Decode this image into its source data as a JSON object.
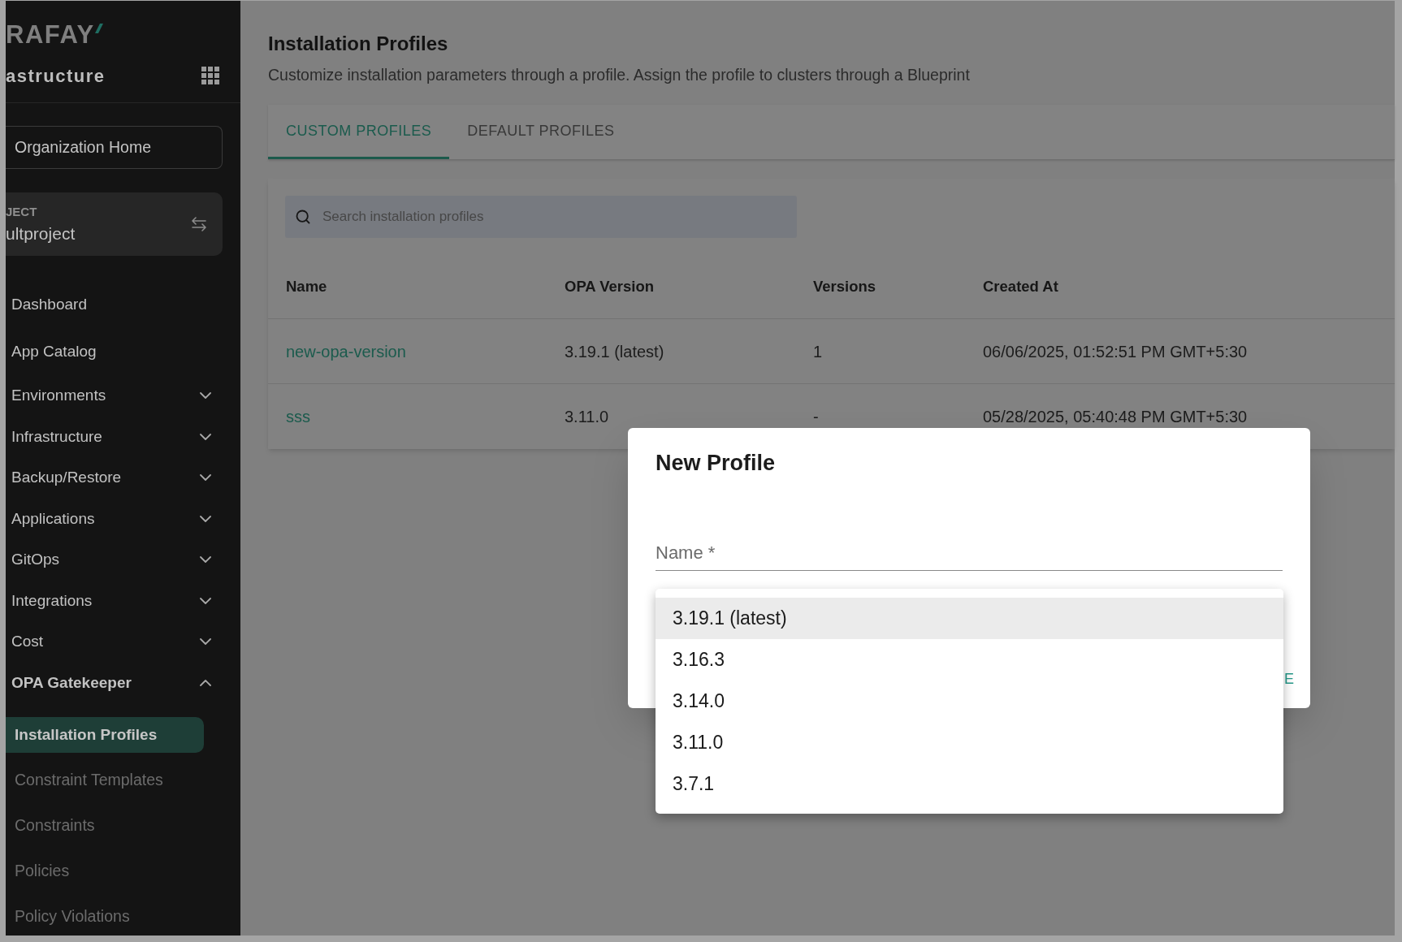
{
  "sidebar": {
    "logo": "RAFAY",
    "workspace": "astructure",
    "org_home": "Organization Home",
    "project": {
      "label": "JECT",
      "name": "ultproject"
    },
    "nav": [
      {
        "label": "Dashboard",
        "kind": "link"
      },
      {
        "label": "App Catalog",
        "kind": "link"
      },
      {
        "label": "Environments",
        "kind": "group",
        "expanded": false
      },
      {
        "label": "Infrastructure",
        "kind": "group",
        "expanded": false
      },
      {
        "label": "Backup/Restore",
        "kind": "group",
        "expanded": false
      },
      {
        "label": "Applications",
        "kind": "group",
        "expanded": false
      },
      {
        "label": "GitOps",
        "kind": "group",
        "expanded": false
      },
      {
        "label": "Integrations",
        "kind": "group",
        "expanded": false
      },
      {
        "label": "Cost",
        "kind": "group",
        "expanded": false
      },
      {
        "label": "OPA Gatekeeper",
        "kind": "group",
        "expanded": true,
        "children": [
          {
            "label": "Installation Profiles",
            "selected": true
          },
          {
            "label": "Constraint Templates",
            "selected": false
          },
          {
            "label": "Constraints",
            "selected": false
          },
          {
            "label": "Policies",
            "selected": false
          },
          {
            "label": "Policy Violations",
            "selected": false
          }
        ]
      }
    ]
  },
  "page": {
    "title": "Installation Profiles",
    "subtitle": "Customize installation parameters through a profile. Assign the profile to clusters through a Blueprint"
  },
  "tabs": [
    {
      "label": "CUSTOM PROFILES",
      "selected": true
    },
    {
      "label": "DEFAULT PROFILES",
      "selected": false
    }
  ],
  "search": {
    "placeholder": "Search installation profiles"
  },
  "table": {
    "columns": [
      "Name",
      "OPA Version",
      "Versions",
      "Created At"
    ],
    "rows": [
      {
        "cells": [
          "new-opa-version",
          "3.19.1 (latest)",
          "1",
          "06/06/2025, 01:52:51 PM GMT+5:30"
        ]
      },
      {
        "cells": [
          "sss",
          "3.11.0",
          "-",
          "05/28/2025, 05:40:48 PM GMT+5:30"
        ]
      }
    ]
  },
  "dialog": {
    "title": "New Profile",
    "name_field": {
      "placeholder": "Name *"
    },
    "action_button": "E",
    "version_menu": [
      {
        "label": "3.19.1 (latest)",
        "selected": true
      },
      {
        "label": "3.16.3",
        "selected": false
      },
      {
        "label": "3.14.0",
        "selected": false
      },
      {
        "label": "3.11.0",
        "selected": false
      },
      {
        "label": "3.7.1",
        "selected": false
      }
    ]
  }
}
